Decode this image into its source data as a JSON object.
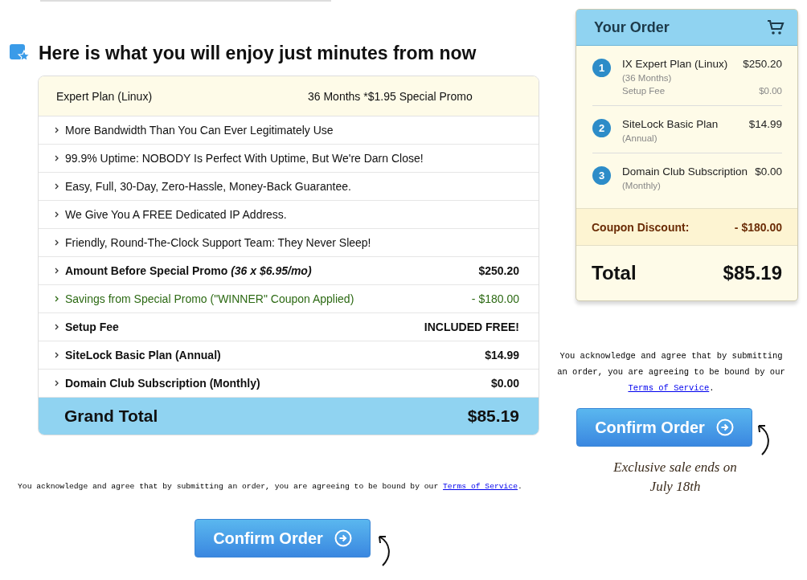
{
  "main": {
    "heading": "Here is what you will enjoy just minutes from now",
    "plan": {
      "name": "Expert Plan (Linux)",
      "term": "36 Months *$1.95 Special Promo"
    },
    "rows": [
      {
        "kind": "feature",
        "label": "More Bandwidth Than You Can Ever Legitimately Use"
      },
      {
        "kind": "feature",
        "label": "99.9% Uptime: NOBODY Is Perfect With Uptime, But We're Darn Close!"
      },
      {
        "kind": "feature",
        "label": "Easy, Full, 30-Day, Zero-Hassle, Money-Back Guarantee."
      },
      {
        "kind": "feature",
        "label": "We Give You A FREE Dedicated IP Address."
      },
      {
        "kind": "feature",
        "label": "Friendly, Round-The-Clock Support Team: They Never Sleep!"
      },
      {
        "kind": "amount",
        "label": "Amount Before Special Promo *(36 x $6.95/mo)*",
        "value": "$250.20"
      },
      {
        "kind": "savings",
        "label": "Savings from Special Promo (\"WINNER\" Coupon Applied)",
        "value": "- $180.00"
      },
      {
        "kind": "amount",
        "label": "Setup Fee",
        "value": "INCLUDED FREE!"
      },
      {
        "kind": "amount",
        "label": "SiteLock Basic Plan (Annual)",
        "value": "$14.99"
      },
      {
        "kind": "amount",
        "label": "Domain Club Subscription (Monthly)",
        "value": "$0.00"
      }
    ],
    "grand_total": {
      "label": "Grand Total",
      "value": "$85.19"
    },
    "terms": {
      "text": "You acknowledge and agree that by submitting an order, you are agreeing to be bound by our",
      "link": "Terms of Service",
      "end": "."
    },
    "button": "Confirm Order"
  },
  "order": {
    "title": "Your Order",
    "items": [
      {
        "number": "1",
        "name": "IX Expert Plan (Linux)",
        "price": "$250.20",
        "details": [
          {
            "label": "(36 Months)"
          },
          {
            "label": "Setup Fee",
            "price": "$0.00"
          }
        ]
      },
      {
        "number": "2",
        "name": "SiteLock Basic Plan",
        "price": "$14.99",
        "details": [
          {
            "label": "(Annual)"
          }
        ]
      },
      {
        "number": "3",
        "name": "Domain Club Subscription",
        "price": "$0.00",
        "details": [
          {
            "label": "(Monthly)"
          }
        ]
      }
    ],
    "coupon": {
      "label": "Coupon Discount:",
      "value": "- $180.00"
    },
    "total": {
      "label": "Total",
      "value": "$85.19"
    },
    "terms": {
      "text": "You acknowledge and agree that by submitting an order, you are agreeing to be bound by our",
      "link": "Terms of Service",
      "end": "."
    },
    "button": "Confirm Order",
    "note": [
      "Exclusive sale ends on",
      "July 18th"
    ]
  }
}
